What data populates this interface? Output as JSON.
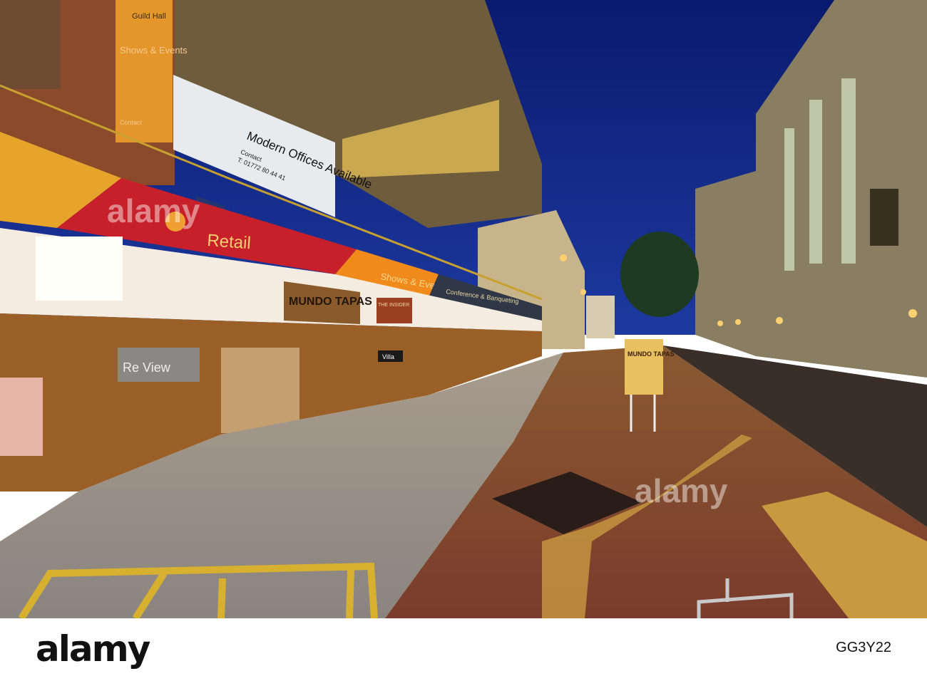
{
  "photo": {
    "watermark": "alamy",
    "guild_hall_sign": {
      "title": "Guild Hall",
      "subtitle": "Shows & Events",
      "contact": "Contact"
    },
    "office_banner": {
      "headline": "Modern Offices Available",
      "contact": "Contact",
      "phone": "T: 01772 80 44 41"
    },
    "retail_banner": "Retail",
    "shows_banner": "Shows & Events",
    "conference_banner": "Conference & Banqueting",
    "restaurant_sign": "MUNDO TAPAS",
    "insider_sign": "THE INSIDER",
    "shop_sign": "Re View",
    "villa_sign": "Villa",
    "street_sign": "MUNDO TAPAS"
  },
  "footer": {
    "logo": "alamy",
    "image_id": "GG3Y22"
  }
}
